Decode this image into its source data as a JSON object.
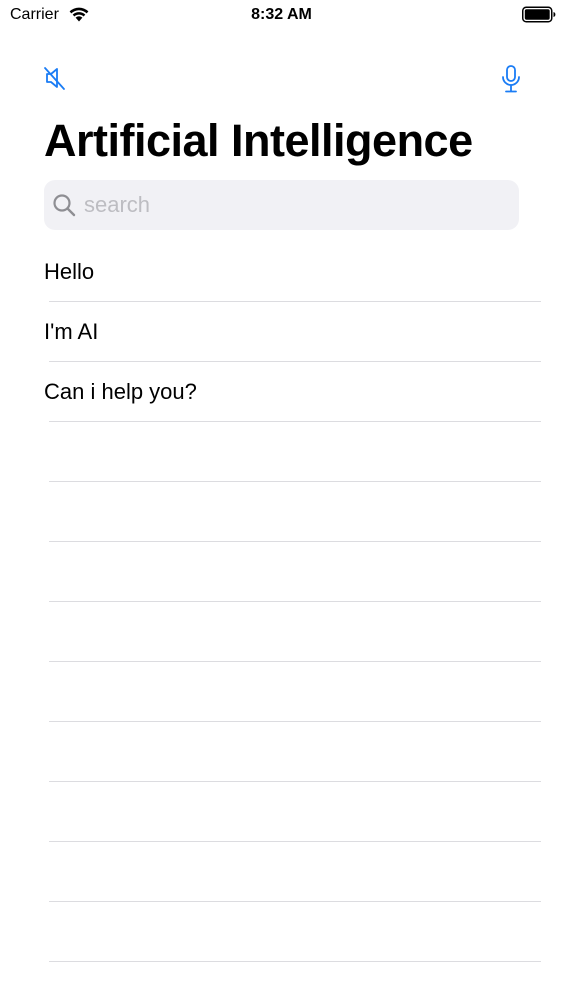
{
  "status_bar": {
    "carrier": "Carrier",
    "time": "8:32 AM",
    "icons": [
      "wifi-icon",
      "battery-icon"
    ]
  },
  "nav": {
    "left_icon": "speaker-muted-icon",
    "right_icon": "microphone-icon",
    "icon_color": "#1a7cf5"
  },
  "page_title": "Artificial Intelligence",
  "search": {
    "placeholder": "search",
    "value": "",
    "icon": "search-icon"
  },
  "messages": [
    {
      "text": "Hello"
    },
    {
      "text": "I'm AI"
    },
    {
      "text": "Can i help you?"
    },
    {
      "text": ""
    },
    {
      "text": ""
    },
    {
      "text": ""
    },
    {
      "text": ""
    },
    {
      "text": ""
    },
    {
      "text": ""
    },
    {
      "text": ""
    },
    {
      "text": ""
    },
    {
      "text": ""
    }
  ],
  "colors": {
    "accent": "#1a7cf5",
    "search_background": "#f1f1f5",
    "placeholder": "#bdbdc2",
    "separator": "#dcdce0"
  }
}
